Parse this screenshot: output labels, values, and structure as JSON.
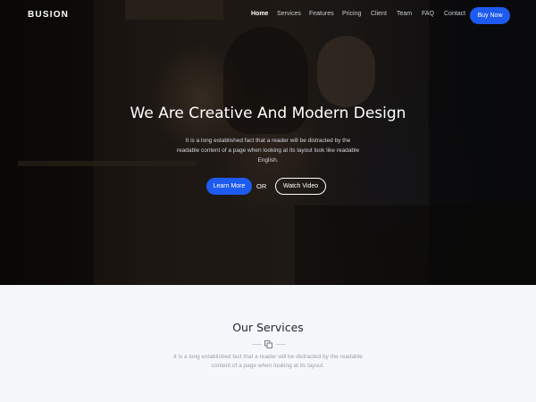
{
  "header": {
    "brand": "BUSION",
    "nav": [
      {
        "label": "Home",
        "active": true
      },
      {
        "label": "Services",
        "active": false
      },
      {
        "label": "Features",
        "active": false
      },
      {
        "label": "Pricing",
        "active": false
      },
      {
        "label": "Client",
        "active": false
      },
      {
        "label": "Team",
        "active": false
      },
      {
        "label": "FAQ",
        "active": false
      },
      {
        "label": "Contact",
        "active": false
      }
    ],
    "buy_label": "Buy Now"
  },
  "hero": {
    "title": "We Are Creative And Modern Design",
    "description": "It is a long established fact that a reader will be distracted by the readable content of a page when looking at its layout look like readable English.",
    "learn_more_label": "Learn More",
    "or_label": "OR",
    "watch_video_label": "Watch Video"
  },
  "services": {
    "title": "Our Services",
    "description": "It is a long established fact that a reader will be distracted by the readable content of a page when looking at its layout.",
    "divider_icon": "copy-icon"
  },
  "colors": {
    "accent": "#1d5bf0",
    "services_bg": "#f5f7fa",
    "title_dark": "#1f2430"
  }
}
